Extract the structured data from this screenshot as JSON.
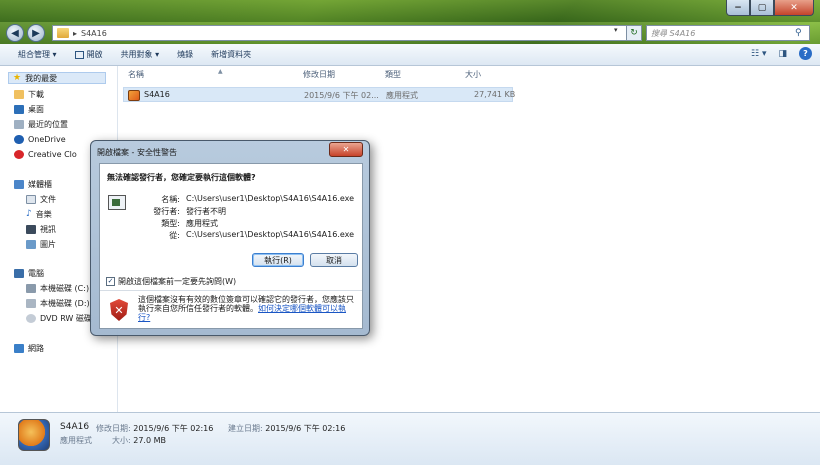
{
  "address": {
    "breadcrumb_sep": "▸",
    "path": "S4A16",
    "search_placeholder": "搜尋 S4A16"
  },
  "window_controls": {
    "minimize": "−",
    "maximize": "▢",
    "close": "✕"
  },
  "toolbar": {
    "organize": "組合管理 ▾",
    "open": "開啟",
    "share": "共用對象 ▾",
    "burn": "燒錄",
    "new_folder": "新增資料夾"
  },
  "nav": {
    "favorites": "我的最愛",
    "downloads": "下載",
    "desktop": "桌面",
    "recent": "最近的位置",
    "onedrive": "OneDrive",
    "creative_cloud": "Creative Clo",
    "libraries": "媒體櫃",
    "documents": "文件",
    "music": "音樂",
    "videos": "視訊",
    "pictures": "圖片",
    "computer": "電腦",
    "disk_c": "本機磁碟 (C:)",
    "disk_d": "本機磁碟 (D:)",
    "dvd": "DVD RW 磁碟",
    "network": "網路"
  },
  "columns": {
    "name": "名稱",
    "date": "修改日期",
    "type": "類型",
    "size": "大小"
  },
  "file": {
    "name": "S4A16",
    "date": "2015/9/6 下午 02...",
    "type": "應用程式",
    "size": "27,741 KB"
  },
  "status": {
    "name": "S4A16",
    "modified_label": "修改日期:",
    "modified": "2015/9/6 下午 02:16",
    "created_label": "建立日期:",
    "created": "2015/9/6 下午 02:16",
    "type": "應用程式",
    "size_label": "大小:",
    "size": "27.0 MB"
  },
  "dialog": {
    "title": "開啟檔案 - 安全性警告",
    "heading": "無法確認發行者，您確定要執行這個軟體?",
    "name_label": "名稱:",
    "name": "C:\\Users\\user1\\Desktop\\S4A16\\S4A16.exe",
    "publisher_label": "發行者:",
    "publisher": "發行者不明",
    "type_label": "類型:",
    "type": "應用程式",
    "from_label": "從:",
    "from": "C:\\Users\\user1\\Desktop\\S4A16\\S4A16.exe",
    "run_button": "執行(R)",
    "cancel_button": "取消",
    "checkbox_label": "開啟這個檔案前一定要先詢問(W)",
    "warning_text": "這個檔案沒有有效的數位簽章可以確認它的發行者，您應該只執行來自您所信任發行者的軟體。",
    "warning_link": "如何決定哪個軟體可以執行?"
  }
}
